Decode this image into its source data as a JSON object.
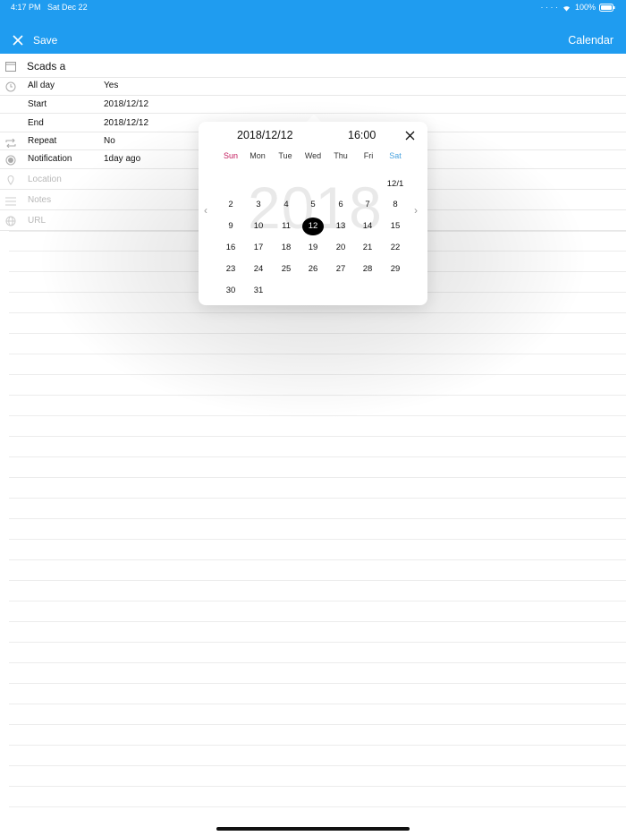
{
  "status_bar": {
    "time": "4:17 PM",
    "date": "Sat Dec 22",
    "battery": "100%"
  },
  "header": {
    "save_label": "Save",
    "calendar_label": "Calendar"
  },
  "form": {
    "title": "Scads a",
    "all_day_label": "All day",
    "all_day_value": "Yes",
    "start_label": "Start",
    "start_value": "2018/12/12",
    "end_label": "End",
    "end_value": "2018/12/12",
    "repeat_label": "Repeat",
    "repeat_value": "No",
    "notification_label": "Notification",
    "notification_value": "1day ago",
    "location_placeholder": "Location",
    "notes_placeholder": "Notes",
    "url_placeholder": "URL"
  },
  "picker": {
    "date": "2018/12/12",
    "time": "16:00",
    "year_watermark": "2018",
    "weekdays": [
      "Sun",
      "Mon",
      "Tue",
      "Wed",
      "Thu",
      "Fri",
      "Sat"
    ],
    "first_day_label": "12/1",
    "days": [
      [
        "2",
        "3",
        "4",
        "5",
        "6",
        "7",
        "8"
      ],
      [
        "9",
        "10",
        "11",
        "12",
        "13",
        "14",
        "15"
      ],
      [
        "16",
        "17",
        "18",
        "19",
        "20",
        "21",
        "22"
      ],
      [
        "23",
        "24",
        "25",
        "26",
        "27",
        "28",
        "29"
      ],
      [
        "30",
        "31",
        "",
        "",
        "",
        "",
        ""
      ]
    ],
    "selected": "12",
    "prev_arrow": "‹",
    "next_arrow": "›"
  },
  "colors": {
    "accent": "#1f9cf0",
    "sunday": "#c2185b",
    "saturday": "#4aa3df"
  }
}
